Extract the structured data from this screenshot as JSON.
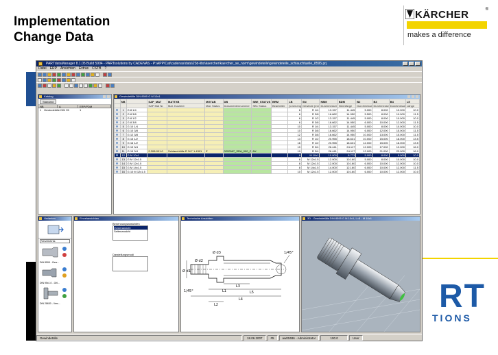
{
  "slide": {
    "title_line1": "Implementation",
    "title_line2": "Change Data"
  },
  "brand": {
    "name": "KÄRCHER",
    "registered_mark": "®",
    "tagline": "makes a difference",
    "stripe_color": "#f3d400"
  },
  "background_logo": {
    "word": "RT",
    "sub": "TIONS",
    "color": "#1d5aa7"
  },
  "app": {
    "title": "PARTdataManager 8.1.05 Build 5904 - PARTsolutions by CADENAS - P:\\APP\\Cat\\cadenas\\data\\23d-libs\\kaercher\\kaercher_se_norm\\gewindeteile\\gewindeteile_schlauchtuelle_8595.prj",
    "menu": [
      "Datei",
      "ERP",
      "Ansichten",
      "Extras",
      "CSTB",
      "?"
    ],
    "tree_pane": {
      "title": "Katalog",
      "button": "Standard",
      "columns": [
        "NB",
        "A",
        "ERP/PDM"
      ],
      "rows": [
        {
          "nb": "1",
          "a": "Gewindetülle DIN 95",
          "erp": "1"
        }
      ]
    },
    "table_pane": {
      "title": "Gewindetülle DIN 8595 G M 10x1",
      "columns": [
        "",
        "NB",
        "",
        "SAP_MAT",
        "MATTXB",
        "MGTAB",
        "DB",
        "SBE_STATUS",
        "BRM",
        "LB",
        "SN",
        "NBM",
        "BDM",
        "B2",
        "B3",
        "B4",
        "L5"
      ],
      "subcolumns": [
        "",
        "",
        "",
        "SAP Mat Nr.",
        "Mat. Kurztext",
        "Mat. Status",
        "Dokumentennummer",
        "SB1 Status",
        "Bearbeiter",
        "(LineLength)",
        "Gewinde (mm)",
        "Durchmesser",
        "Nennlänge",
        "Durchmesser",
        "Durchmesser",
        "Durchmesser",
        "Länge"
      ],
      "rows": [
        {
          "idx": "1",
          "nb": "G 8 1/4",
          "sap": "",
          "txt": "",
          "stat": "",
          "db": "",
          "sbe": "",
          "brm": "",
          "lb": "6",
          "sn": "R 1/4",
          "nbm": "13.157",
          "bdm": "11.445",
          "b2": "5.000",
          "b3": "8.000",
          "b4": "10.000",
          "l5": "10.0"
        },
        {
          "idx": "2",
          "nb": "G 8 3/8",
          "sap": "",
          "txt": "",
          "stat": "",
          "db": "",
          "sbe": "",
          "brm": "",
          "lb": "6",
          "sn": "R 3/8",
          "nbm": "16.662",
          "bdm": "14.950",
          "b2": "5.500",
          "b3": "8.000",
          "b4": "10.000",
          "l5": "11.5"
        },
        {
          "idx": "3",
          "nb": "G 8 1/2",
          "sap": "",
          "txt": "",
          "stat": "",
          "db": "",
          "sbe": "",
          "brm": "",
          "lb": "6",
          "sn": "R 1/2",
          "nbm": "13.157",
          "bdm": "11.445",
          "b2": "5.000",
          "b3": "8.000",
          "b4": "10.000",
          "l5": "10.0"
        },
        {
          "idx": "4",
          "nb": "G 8 3/8",
          "sap": "",
          "txt": "",
          "stat": "",
          "db": "",
          "sbe": "",
          "brm": "",
          "lb": "6",
          "sn": "R 3/8",
          "nbm": "16.662",
          "bdm": "14.950",
          "b2": "6.000",
          "b3": "10.000",
          "b4": "12.000",
          "l5": "11.5"
        },
        {
          "idx": "5",
          "nb": "G 10 1/4",
          "sap": "",
          "txt": "",
          "stat": "",
          "db": "",
          "sbe": "",
          "brm": "",
          "lb": "10",
          "sn": "R 1/4",
          "nbm": "13.157",
          "bdm": "11.445",
          "b2": "5.000",
          "b3": "8.000",
          "b4": "10.000",
          "l5": "10.0"
        },
        {
          "idx": "6",
          "nb": "G 10 3/8",
          "sap": "",
          "txt": "",
          "stat": "",
          "db": "",
          "sbe": "",
          "brm": "",
          "lb": "10",
          "sn": "R 3/8",
          "nbm": "16.662",
          "bdm": "14.950",
          "b2": "6.000",
          "b3": "12.000",
          "b4": "15.000",
          "l5": "11.5"
        },
        {
          "idx": "7",
          "nb": "G 12 3/8",
          "sap": "",
          "txt": "",
          "stat": "",
          "db": "",
          "sbe": "",
          "brm": "",
          "lb": "12",
          "sn": "R 3/8",
          "nbm": "16.662",
          "bdm": "14.950",
          "b2": "10.000",
          "b3": "13.000",
          "b4": "15.000",
          "l5": "11.5"
        },
        {
          "idx": "8",
          "nb": "G 13 1/2",
          "sap": "",
          "txt": "",
          "stat": "",
          "db": "",
          "sbe": "",
          "brm": "",
          "lb": "13",
          "sn": "R 1/2",
          "nbm": "20.955",
          "bdm": "18.631",
          "b2": "10.000",
          "b3": "15.000",
          "b4": "18.000",
          "l5": "13.5"
        },
        {
          "idx": "9",
          "nb": "G 16 1/2",
          "sap": "",
          "txt": "",
          "stat": "",
          "db": "",
          "sbe": "",
          "brm": "",
          "lb": "16",
          "sn": "R 1/2",
          "nbm": "20.955",
          "bdm": "18.631",
          "b2": "12.000",
          "b3": "15.000",
          "b4": "18.000",
          "l5": "13.5"
        },
        {
          "idx": "10",
          "nb": "G 19 3/4",
          "sap": "",
          "txt": "",
          "stat": "",
          "db": "",
          "sbe": "",
          "brm": "",
          "lb": "19",
          "sn": "R 3/4",
          "nbm": "26.441",
          "bdm": "24.117",
          "b2": "12.000",
          "b3": "17.000",
          "b4": "19.000",
          "l5": "16.0"
        },
        {
          "idx": "11",
          "nb": "G 19 3/4",
          "sap": "2.308-001.0",
          "txt": "Schlauchtülle R 3/4\" 1.4301",
          "stat": "Z",
          "db": "0220067_SRA_000_CB",
          "sbe": "AX",
          "brm": "",
          "lb": "19",
          "sn": "R 3/4",
          "nbm": "26.441",
          "bdm": "24.117",
          "b2": "12.000",
          "b3": "21.000",
          "b4": "23.000",
          "l5": "16.0"
        },
        {
          "idx": "12",
          "nb": "G M 10x1",
          "sap": "",
          "txt": "",
          "stat": "",
          "db": "",
          "sbe": "",
          "brm": "",
          "lb": "6",
          "sn": "M 10x1",
          "nbm": "10.000",
          "bdm": "8.773",
          "b2": "5.000",
          "b3": "8.000",
          "b4": "9.000",
          "l5": "10.0",
          "selected": true
        },
        {
          "idx": "13",
          "nb": "G M 12x1.5",
          "sap": "",
          "txt": "",
          "stat": "",
          "db": "",
          "sbe": "",
          "brm": "",
          "lb": "6",
          "sn": "M 12x1.5",
          "nbm": "12.000",
          "bdm": "10.160",
          "b2": "5.000",
          "b3": "8.000",
          "b4": "10.000",
          "l5": "10.0"
        },
        {
          "idx": "14",
          "nb": "G M 12x1.5",
          "sap": "",
          "txt": "",
          "stat": "",
          "db": "",
          "sbe": "",
          "brm": "",
          "lb": "8",
          "sn": "M 12x1.5",
          "nbm": "12.000",
          "bdm": "10.160",
          "b2": "6.000",
          "b3": "10.000",
          "b4": "12.000",
          "l5": "10.0"
        },
        {
          "idx": "15",
          "nb": "G M 14x1.5",
          "sap": "",
          "txt": "",
          "stat": "",
          "db": "",
          "sbe": "",
          "brm": "",
          "lb": "8",
          "sn": "M 14x1.5",
          "nbm": "14.000",
          "bdm": "12.160",
          "b2": "6.000",
          "b3": "10.000",
          "b4": "12.000",
          "l5": "11.5"
        },
        {
          "idx": "16",
          "nb": "G 10 M 12x1.5",
          "sap": "",
          "txt": "",
          "stat": "",
          "db": "",
          "sbe": "",
          "brm": "",
          "lb": "10",
          "sn": "M 12x1.5",
          "nbm": "12.000",
          "bdm": "10.160",
          "b2": "6.000",
          "b3": "10.000",
          "b4": "12.000",
          "l5": "10.0"
        }
      ]
    },
    "vis_pane": {
      "title": "Varianten",
      "combo": "Verzeichnis",
      "captions": [
        "DIN 8595 - Gew...",
        "DIN 95x1.0 - Gril...",
        "DIN 28630 - Vers..."
      ]
    },
    "detail_pane": {
      "title": "Einzelansichten",
      "list_label": "Benennungsansichten",
      "list_items": [
        "Vorderansicht",
        "Seitenansicht"
      ],
      "second_label": "Darstellungsmodi"
    },
    "draw_pane": {
      "title": "Technische Ansichten",
      "dims": [
        "L4",
        "L5",
        "L3",
        "L2",
        "L1",
        "Ø d1",
        "Ø d2",
        "Ø d3",
        "1/45°",
        "1/45°"
      ]
    },
    "view3d_pane": {
      "title": "3D - Gewindetülle DIN 8595 G M 10x1, L=8 - M 10x1"
    },
    "status": {
      "left": "Gewindetülle",
      "date": "18.06.2007",
      "num": "#5",
      "user": "aw00486 - Administrator",
      "value": "100.0",
      "mode": "User"
    }
  }
}
